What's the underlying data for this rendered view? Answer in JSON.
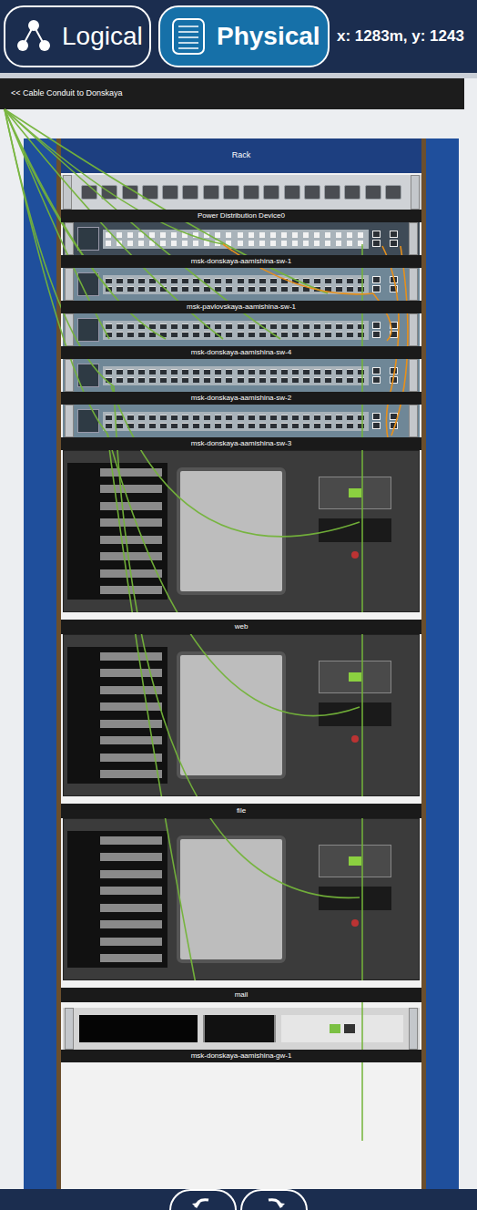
{
  "toolbar": {
    "tabs": [
      {
        "label": "Logical",
        "selected": false,
        "kind": "logical"
      },
      {
        "label": "Physical",
        "selected": true,
        "kind": "physical"
      }
    ],
    "coordinates": "x: 1283m, y: 1243"
  },
  "conduit": {
    "label": "<< Cable Conduit to Donskaya"
  },
  "rack": {
    "title": "Rack",
    "devices": [
      {
        "name": "Power Distribution Device0",
        "kind": "pdu"
      },
      {
        "name": "msk-donskaya-aamishina-sw-1",
        "kind": "multilayer"
      },
      {
        "name": "msk-pavlovskaya-aamishina-sw-1",
        "kind": "switch"
      },
      {
        "name": "msk-donskaya-aamishina-sw-4",
        "kind": "switch"
      },
      {
        "name": "msk-donskaya-aamishina-sw-2",
        "kind": "switch"
      },
      {
        "name": "msk-donskaya-aamishina-sw-3",
        "kind": "switch"
      },
      {
        "name": "web",
        "kind": "server"
      },
      {
        "name": "file",
        "kind": "server"
      },
      {
        "name": "mail",
        "kind": "server"
      },
      {
        "name": "msk-donskaya-aamishina-gw-1",
        "kind": "router"
      }
    ]
  }
}
